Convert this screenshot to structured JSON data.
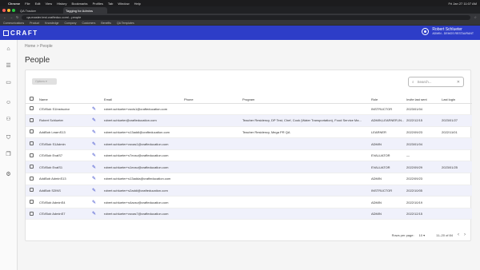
{
  "macbar": {
    "apple": "",
    "app": "Chrome",
    "menus": [
      "File",
      "Edit",
      "View",
      "History",
      "Bookmarks",
      "Profiles",
      "Tab",
      "Window",
      "Help"
    ],
    "clock": "Fri Jan 27 11:07 AM"
  },
  "browser": {
    "tabs": [
      "QA Tracker",
      "Tagging for Admins"
    ],
    "url": "qa-master.test.crafteduc.com/...people",
    "bookmarks": [
      "Communications",
      "Product",
      "Knowledge",
      "Company",
      "Customers",
      "Benefits",
      "QA Templates"
    ]
  },
  "app": {
    "logo": "CRAFT",
    "user_name": "Robert Schlueter",
    "user_role": "ADMIN - DEMOS RESTAURANT"
  },
  "breadcrumb": {
    "home": "Home",
    "sep": ">",
    "current": "People"
  },
  "page_title": "People",
  "toolbar": {
    "options_label": "Options",
    "search_placeholder": "Search..."
  },
  "columns": [
    "Name",
    "Email",
    "Phone",
    "Program",
    "Role",
    "Invite last sent",
    "Last login"
  ],
  "rows": [
    {
      "name": "CSVBob S1Instructor",
      "email": "robert.schlueter+csvis1@crafteducation.com",
      "phone": "",
      "program": "",
      "role": "INSTRUCTOR",
      "invite": "2023/01/04",
      "login": ""
    },
    {
      "name": "Robert Schlueter",
      "email": "robert.schlueter@crafteducation.com",
      "phone": "",
      "program": "Teacher Residency, DP Test, Chef, Cook (Water Transportation), Food Service Ma...",
      "role": "ADMIN,LEARNER,IN...",
      "invite": "2022/12/15",
      "login": "2023/01/27"
    },
    {
      "name": "AddBob LearnS13",
      "email": "robert.schlueter+s13addl@crafteducation.com",
      "phone": "",
      "program": "Teacher Residency, Mega PR QA",
      "role": "LEARNER",
      "invite": "2022/09/23",
      "login": "2022/11/01"
    },
    {
      "name": "CSVBob S1Admin",
      "email": "robert.schlueter+csvas1@crafteducation.com",
      "phone": "",
      "program": "",
      "role": "ADMIN",
      "invite": "2023/01/04",
      "login": ""
    },
    {
      "name": "CSVBob EvalS7",
      "email": "robert.schlueter+s7ecsv@crafteducation.com",
      "phone": "",
      "program": "",
      "role": "EVALUATOR",
      "invite": "—",
      "login": ""
    },
    {
      "name": "CSVBob EvalS1",
      "email": "robert.schlueter+s1ecsv@crafteducation.com",
      "phone": "",
      "program": "",
      "role": "EVALUATOR",
      "invite": "2022/09/29",
      "login": "2023/01/25"
    },
    {
      "name": "AddBob AdminS13",
      "email": "robert.schlueter+s13adda@crafteducation.com",
      "phone": "",
      "program": "",
      "role": "ADMIN",
      "invite": "2022/09/23",
      "login": ""
    },
    {
      "name": "AddBob S2INS",
      "email": "robert.schlueter+s2addi@crafteducation.com",
      "phone": "",
      "program": "",
      "role": "INSTRUCTOR",
      "invite": "2022/10/05",
      "login": ""
    },
    {
      "name": "CSVBob AdminS4",
      "email": "robert.schlueter+s4acsv@crafteducation.com",
      "phone": "",
      "program": "",
      "role": "ADMIN",
      "invite": "2022/10/19",
      "login": ""
    },
    {
      "name": "CSVBob AdminS7",
      "email": "robert.schlueter+csvas7@crafteducation.com",
      "phone": "",
      "program": "",
      "role": "ADMIN",
      "invite": "2022/12/15",
      "login": ""
    }
  ],
  "pagination": {
    "rows_label": "Rows per page:",
    "rows_value": "10",
    "range": "11–20 of 84"
  }
}
